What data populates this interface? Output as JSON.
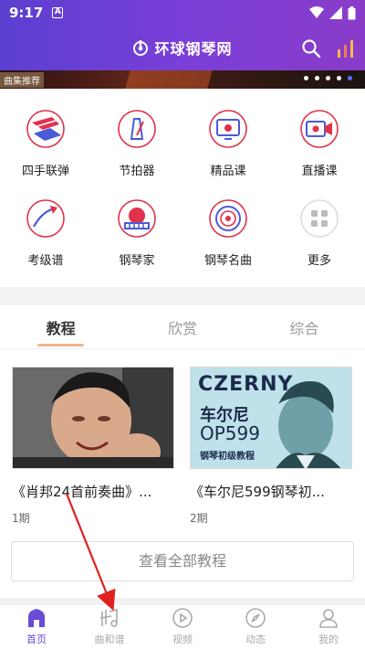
{
  "status": {
    "time": "9:17",
    "a_badge": "A"
  },
  "header": {
    "title": "环球钢琴网"
  },
  "banner": {
    "tag": "曲集推荐"
  },
  "grid": [
    {
      "label": "四手联弹",
      "icon": "four-hands-icon"
    },
    {
      "label": "节拍器",
      "icon": "metronome-icon"
    },
    {
      "label": "精品课",
      "icon": "premium-course-icon"
    },
    {
      "label": "直播课",
      "icon": "live-course-icon"
    },
    {
      "label": "考级谱",
      "icon": "exam-score-icon"
    },
    {
      "label": "钢琴家",
      "icon": "pianist-icon"
    },
    {
      "label": "钢琴名曲",
      "icon": "famous-pieces-icon"
    },
    {
      "label": "更多",
      "icon": "more-icon"
    }
  ],
  "tabs": [
    {
      "label": "教程",
      "active": true
    },
    {
      "label": "欣赏",
      "active": false
    },
    {
      "label": "综合",
      "active": false
    }
  ],
  "cards": [
    {
      "title": "《肖邦24首前奏曲》...",
      "episodes": "1期"
    },
    {
      "title": "《车尔尼599钢琴初...",
      "episodes": "2期",
      "thumb_word": "CZERNY",
      "thumb_cn": "车尔尼",
      "thumb_op": "OP599",
      "thumb_sub": "钢琴初级教程"
    }
  ],
  "all_button": "查看全部教程",
  "nav": [
    {
      "label": "首页",
      "icon": "home-icon",
      "active": true
    },
    {
      "label": "曲和谱",
      "icon": "score-icon",
      "active": false
    },
    {
      "label": "视频",
      "icon": "video-icon",
      "active": false
    },
    {
      "label": "动态",
      "icon": "compass-icon",
      "active": false
    },
    {
      "label": "我的",
      "icon": "user-icon",
      "active": false
    }
  ],
  "colors": {
    "header_start": "#5a3fd0",
    "accent": "#6a4bd8",
    "icon_red": "#e0324a",
    "icon_blue": "#4a5bd8",
    "arrow": "#e02020"
  }
}
